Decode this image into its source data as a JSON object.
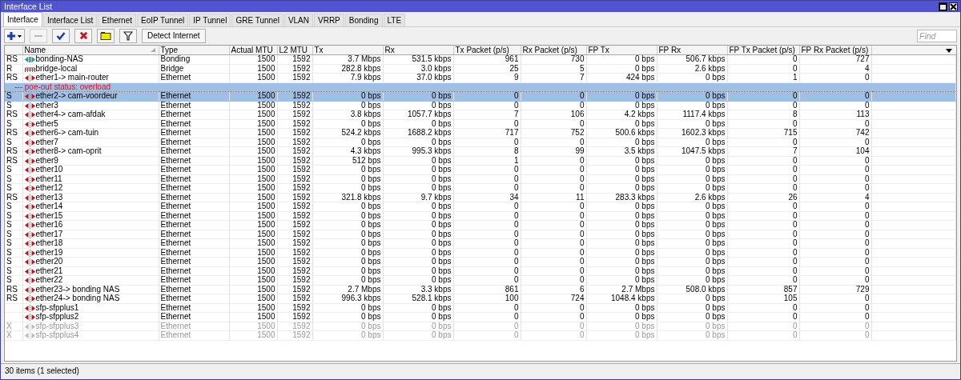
{
  "window": {
    "title": "Interface List"
  },
  "tabs": [
    {
      "label": "Interface",
      "selected": true
    },
    {
      "label": "Interface List",
      "selected": false
    },
    {
      "label": "Ethernet",
      "selected": false
    },
    {
      "label": "EoIP Tunnel",
      "selected": false
    },
    {
      "label": "IP Tunnel",
      "selected": false
    },
    {
      "label": "GRE Tunnel",
      "selected": false
    },
    {
      "label": "VLAN",
      "selected": false
    },
    {
      "label": "VRRP",
      "selected": false
    },
    {
      "label": "Bonding",
      "selected": false
    },
    {
      "label": "LTE",
      "selected": false
    }
  ],
  "toolbar": {
    "tools": [
      {
        "kind": "add",
        "disabled": false
      },
      {
        "kind": "remove",
        "disabled": true
      },
      {
        "kind": "enable",
        "disabled": false
      },
      {
        "kind": "disable",
        "disabled": false
      },
      {
        "kind": "comment",
        "disabled": false
      },
      {
        "kind": "filter",
        "disabled": false
      }
    ],
    "detect_button": "Detect Internet"
  },
  "search": {
    "placeholder": "Find"
  },
  "table": {
    "columns": [
      {
        "label": "Name",
        "sorted": true
      },
      {
        "label": "Type"
      },
      {
        "label": "Actual MTU"
      },
      {
        "label": "L2 MTU"
      },
      {
        "label": "Tx"
      },
      {
        "label": "Rx"
      },
      {
        "label": "Tx Packet (p/s)"
      },
      {
        "label": "Rx Packet (p/s)"
      },
      {
        "label": "FP Tx"
      },
      {
        "label": "FP Rx"
      },
      {
        "label": "FP Tx Packet (p/s)"
      },
      {
        "label": "FP Rx Packet (p/s)"
      }
    ],
    "rows": [
      {
        "flags": "RS",
        "kind": "bonding",
        "name": "bonding-NAS",
        "type": "Bonding",
        "actual_mtu": "1500",
        "l2_mtu": "1592",
        "tx": "3.7 Mbps",
        "rx": "531.5 kbps",
        "tx_packet": "961",
        "rx_packet": "730",
        "fp_tx": "0 bps",
        "fp_rx": "506.7 kbps",
        "fp_tx_packet": "0",
        "fp_rx_packet": "727",
        "selected": false,
        "disabled": false
      },
      {
        "flags": "R",
        "kind": "bridge",
        "name": "bridge-local",
        "type": "Bridge",
        "actual_mtu": "1500",
        "l2_mtu": "1592",
        "tx": "282.8 kbps",
        "rx": "3.0 kbps",
        "tx_packet": "25",
        "rx_packet": "5",
        "fp_tx": "0 bps",
        "fp_rx": "2.6 kbps",
        "fp_tx_packet": "0",
        "fp_rx_packet": "4",
        "selected": false,
        "disabled": false
      },
      {
        "flags": "RS",
        "kind": "ethernet",
        "name": "ether1-> main-router",
        "type": "Ethernet",
        "actual_mtu": "1500",
        "l2_mtu": "1592",
        "tx": "7.9 kbps",
        "rx": "37.0 kbps",
        "tx_packet": "9",
        "rx_packet": "7",
        "fp_tx": "424 bps",
        "fp_rx": "0 bps",
        "fp_tx_packet": "1",
        "fp_rx_packet": "0",
        "selected": false,
        "disabled": false
      },
      {
        "comment": "--- poe-out status: overload",
        "flags": "S",
        "kind": "ethernet",
        "name": "ether2-> cam-voordeur",
        "type": "Ethernet",
        "actual_mtu": "1500",
        "l2_mtu": "1592",
        "tx": "0 bps",
        "rx": "0 bps",
        "tx_packet": "0",
        "rx_packet": "0",
        "fp_tx": "0 bps",
        "fp_rx": "0 bps",
        "fp_tx_packet": "0",
        "fp_rx_packet": "0",
        "selected": true,
        "disabled": false
      },
      {
        "flags": "S",
        "kind": "ethernet",
        "name": "ether3",
        "type": "Ethernet",
        "actual_mtu": "1500",
        "l2_mtu": "1592",
        "tx": "0 bps",
        "rx": "0 bps",
        "tx_packet": "0",
        "rx_packet": "0",
        "fp_tx": "0 bps",
        "fp_rx": "0 bps",
        "fp_tx_packet": "0",
        "fp_rx_packet": "0",
        "selected": false,
        "disabled": false
      },
      {
        "flags": "RS",
        "kind": "ethernet",
        "name": "ether4-> cam-afdak",
        "type": "Ethernet",
        "actual_mtu": "1500",
        "l2_mtu": "1592",
        "tx": "3.8 kbps",
        "rx": "1057.7 kbps",
        "tx_packet": "7",
        "rx_packet": "106",
        "fp_tx": "4.2 kbps",
        "fp_rx": "1117.4 kbps",
        "fp_tx_packet": "8",
        "fp_rx_packet": "113",
        "selected": false,
        "disabled": false
      },
      {
        "flags": "S",
        "kind": "ethernet",
        "name": "ether5",
        "type": "Ethernet",
        "actual_mtu": "1500",
        "l2_mtu": "1592",
        "tx": "0 bps",
        "rx": "0 bps",
        "tx_packet": "0",
        "rx_packet": "0",
        "fp_tx": "0 bps",
        "fp_rx": "0 bps",
        "fp_tx_packet": "0",
        "fp_rx_packet": "0",
        "selected": false,
        "disabled": false
      },
      {
        "flags": "RS",
        "kind": "ethernet",
        "name": "ether6-> cam-tuin",
        "type": "Ethernet",
        "actual_mtu": "1500",
        "l2_mtu": "1592",
        "tx": "524.2 kbps",
        "rx": "1688.2 kbps",
        "tx_packet": "717",
        "rx_packet": "752",
        "fp_tx": "500.6 kbps",
        "fp_rx": "1602.3 kbps",
        "fp_tx_packet": "715",
        "fp_rx_packet": "742",
        "selected": false,
        "disabled": false
      },
      {
        "flags": "S",
        "kind": "ethernet",
        "name": "ether7",
        "type": "Ethernet",
        "actual_mtu": "1500",
        "l2_mtu": "1592",
        "tx": "0 bps",
        "rx": "0 bps",
        "tx_packet": "0",
        "rx_packet": "0",
        "fp_tx": "0 bps",
        "fp_rx": "0 bps",
        "fp_tx_packet": "0",
        "fp_rx_packet": "0",
        "selected": false,
        "disabled": false
      },
      {
        "flags": "RS",
        "kind": "ethernet",
        "name": "ether8-> cam-oprit",
        "type": "Ethernet",
        "actual_mtu": "1500",
        "l2_mtu": "1592",
        "tx": "4.3 kbps",
        "rx": "995.3 kbps",
        "tx_packet": "8",
        "rx_packet": "99",
        "fp_tx": "3.5 kbps",
        "fp_rx": "1047.5 kbps",
        "fp_tx_packet": "7",
        "fp_rx_packet": "104",
        "selected": false,
        "disabled": false
      },
      {
        "flags": "RS",
        "kind": "ethernet",
        "name": "ether9",
        "type": "Ethernet",
        "actual_mtu": "1500",
        "l2_mtu": "1592",
        "tx": "512 bps",
        "rx": "0 bps",
        "tx_packet": "1",
        "rx_packet": "0",
        "fp_tx": "0 bps",
        "fp_rx": "0 bps",
        "fp_tx_packet": "0",
        "fp_rx_packet": "0",
        "selected": false,
        "disabled": false
      },
      {
        "flags": "S",
        "kind": "ethernet",
        "name": "ether10",
        "type": "Ethernet",
        "actual_mtu": "1500",
        "l2_mtu": "1592",
        "tx": "0 bps",
        "rx": "0 bps",
        "tx_packet": "0",
        "rx_packet": "0",
        "fp_tx": "0 bps",
        "fp_rx": "0 bps",
        "fp_tx_packet": "0",
        "fp_rx_packet": "0",
        "selected": false,
        "disabled": false
      },
      {
        "flags": "S",
        "kind": "ethernet",
        "name": "ether11",
        "type": "Ethernet",
        "actual_mtu": "1500",
        "l2_mtu": "1592",
        "tx": "0 bps",
        "rx": "0 bps",
        "tx_packet": "0",
        "rx_packet": "0",
        "fp_tx": "0 bps",
        "fp_rx": "0 bps",
        "fp_tx_packet": "0",
        "fp_rx_packet": "0",
        "selected": false,
        "disabled": false
      },
      {
        "flags": "S",
        "kind": "ethernet",
        "name": "ether12",
        "type": "Ethernet",
        "actual_mtu": "1500",
        "l2_mtu": "1592",
        "tx": "0 bps",
        "rx": "0 bps",
        "tx_packet": "0",
        "rx_packet": "0",
        "fp_tx": "0 bps",
        "fp_rx": "0 bps",
        "fp_tx_packet": "0",
        "fp_rx_packet": "0",
        "selected": false,
        "disabled": false
      },
      {
        "flags": "RS",
        "kind": "ethernet",
        "name": "ether13",
        "type": "Ethernet",
        "actual_mtu": "1500",
        "l2_mtu": "1592",
        "tx": "321.8 kbps",
        "rx": "9.7 kbps",
        "tx_packet": "34",
        "rx_packet": "11",
        "fp_tx": "283.3 kbps",
        "fp_rx": "2.6 kbps",
        "fp_tx_packet": "26",
        "fp_rx_packet": "4",
        "selected": false,
        "disabled": false
      },
      {
        "flags": "S",
        "kind": "ethernet",
        "name": "ether14",
        "type": "Ethernet",
        "actual_mtu": "1500",
        "l2_mtu": "1592",
        "tx": "0 bps",
        "rx": "0 bps",
        "tx_packet": "0",
        "rx_packet": "0",
        "fp_tx": "0 bps",
        "fp_rx": "0 bps",
        "fp_tx_packet": "0",
        "fp_rx_packet": "0",
        "selected": false,
        "disabled": false
      },
      {
        "flags": "S",
        "kind": "ethernet",
        "name": "ether15",
        "type": "Ethernet",
        "actual_mtu": "1500",
        "l2_mtu": "1592",
        "tx": "0 bps",
        "rx": "0 bps",
        "tx_packet": "0",
        "rx_packet": "0",
        "fp_tx": "0 bps",
        "fp_rx": "0 bps",
        "fp_tx_packet": "0",
        "fp_rx_packet": "0",
        "selected": false,
        "disabled": false
      },
      {
        "flags": "S",
        "kind": "ethernet",
        "name": "ether16",
        "type": "Ethernet",
        "actual_mtu": "1500",
        "l2_mtu": "1592",
        "tx": "0 bps",
        "rx": "0 bps",
        "tx_packet": "0",
        "rx_packet": "0",
        "fp_tx": "0 bps",
        "fp_rx": "0 bps",
        "fp_tx_packet": "0",
        "fp_rx_packet": "0",
        "selected": false,
        "disabled": false
      },
      {
        "flags": "S",
        "kind": "ethernet",
        "name": "ether17",
        "type": "Ethernet",
        "actual_mtu": "1500",
        "l2_mtu": "1592",
        "tx": "0 bps",
        "rx": "0 bps",
        "tx_packet": "0",
        "rx_packet": "0",
        "fp_tx": "0 bps",
        "fp_rx": "0 bps",
        "fp_tx_packet": "0",
        "fp_rx_packet": "0",
        "selected": false,
        "disabled": false
      },
      {
        "flags": "S",
        "kind": "ethernet",
        "name": "ether18",
        "type": "Ethernet",
        "actual_mtu": "1500",
        "l2_mtu": "1592",
        "tx": "0 bps",
        "rx": "0 bps",
        "tx_packet": "0",
        "rx_packet": "0",
        "fp_tx": "0 bps",
        "fp_rx": "0 bps",
        "fp_tx_packet": "0",
        "fp_rx_packet": "0",
        "selected": false,
        "disabled": false
      },
      {
        "flags": "S",
        "kind": "ethernet",
        "name": "ether19",
        "type": "Ethernet",
        "actual_mtu": "1500",
        "l2_mtu": "1592",
        "tx": "0 bps",
        "rx": "0 bps",
        "tx_packet": "0",
        "rx_packet": "0",
        "fp_tx": "0 bps",
        "fp_rx": "0 bps",
        "fp_tx_packet": "0",
        "fp_rx_packet": "0",
        "selected": false,
        "disabled": false
      },
      {
        "flags": "S",
        "kind": "ethernet",
        "name": "ether20",
        "type": "Ethernet",
        "actual_mtu": "1500",
        "l2_mtu": "1592",
        "tx": "0 bps",
        "rx": "0 bps",
        "tx_packet": "0",
        "rx_packet": "0",
        "fp_tx": "0 bps",
        "fp_rx": "0 bps",
        "fp_tx_packet": "0",
        "fp_rx_packet": "0",
        "selected": false,
        "disabled": false
      },
      {
        "flags": "S",
        "kind": "ethernet",
        "name": "ether21",
        "type": "Ethernet",
        "actual_mtu": "1500",
        "l2_mtu": "1592",
        "tx": "0 bps",
        "rx": "0 bps",
        "tx_packet": "0",
        "rx_packet": "0",
        "fp_tx": "0 bps",
        "fp_rx": "0 bps",
        "fp_tx_packet": "0",
        "fp_rx_packet": "0",
        "selected": false,
        "disabled": false
      },
      {
        "flags": "S",
        "kind": "ethernet",
        "name": "ether22",
        "type": "Ethernet",
        "actual_mtu": "1500",
        "l2_mtu": "1592",
        "tx": "0 bps",
        "rx": "0 bps",
        "tx_packet": "0",
        "rx_packet": "0",
        "fp_tx": "0 bps",
        "fp_rx": "0 bps",
        "fp_tx_packet": "0",
        "fp_rx_packet": "0",
        "selected": false,
        "disabled": false
      },
      {
        "flags": "RS",
        "kind": "ethernet",
        "name": "ether23-> bonding NAS",
        "type": "Ethernet",
        "actual_mtu": "1500",
        "l2_mtu": "1592",
        "tx": "2.7 Mbps",
        "rx": "3.3 kbps",
        "tx_packet": "861",
        "rx_packet": "6",
        "fp_tx": "2.7 Mbps",
        "fp_rx": "508.0 kbps",
        "fp_tx_packet": "857",
        "fp_rx_packet": "729",
        "selected": false,
        "disabled": false
      },
      {
        "flags": "RS",
        "kind": "ethernet",
        "name": "ether24-> bonding NAS",
        "type": "Ethernet",
        "actual_mtu": "1500",
        "l2_mtu": "1592",
        "tx": "996.3 kbps",
        "rx": "528.1 kbps",
        "tx_packet": "100",
        "rx_packet": "724",
        "fp_tx": "1048.4 kbps",
        "fp_rx": "0 bps",
        "fp_tx_packet": "105",
        "fp_rx_packet": "0",
        "selected": false,
        "disabled": false
      },
      {
        "kind": "ethernet",
        "name": "sfp-sfpplus1",
        "type": "Ethernet",
        "actual_mtu": "1500",
        "l2_mtu": "1592",
        "tx": "0 bps",
        "rx": "0 bps",
        "tx_packet": "0",
        "rx_packet": "0",
        "fp_tx": "0 bps",
        "fp_rx": "0 bps",
        "fp_tx_packet": "0",
        "fp_rx_packet": "0",
        "selected": false,
        "disabled": false
      },
      {
        "kind": "ethernet",
        "name": "sfp-sfpplus2",
        "type": "Ethernet",
        "actual_mtu": "1500",
        "l2_mtu": "1592",
        "tx": "0 bps",
        "rx": "0 bps",
        "tx_packet": "0",
        "rx_packet": "0",
        "fp_tx": "0 bps",
        "fp_rx": "0 bps",
        "fp_tx_packet": "0",
        "fp_rx_packet": "0",
        "selected": false,
        "disabled": false
      },
      {
        "flags": "X",
        "kind": "ethernet",
        "name": "sfp-sfpplus3",
        "type": "Ethernet",
        "actual_mtu": "1500",
        "l2_mtu": "1592",
        "tx": "0 bps",
        "rx": "0 bps",
        "tx_packet": "0",
        "rx_packet": "0",
        "fp_tx": "0 bps",
        "fp_rx": "0 bps",
        "fp_tx_packet": "0",
        "fp_rx_packet": "0",
        "selected": false,
        "disabled": true
      },
      {
        "flags": "X",
        "kind": "ethernet",
        "name": "sfp-sfpplus4",
        "type": "Ethernet",
        "actual_mtu": "1500",
        "l2_mtu": "1592",
        "tx": "0 bps",
        "rx": "0 bps",
        "tx_packet": "0",
        "rx_packet": "0",
        "fp_tx": "0 bps",
        "fp_rx": "0 bps",
        "fp_tx_packet": "0",
        "fp_rx_packet": "0",
        "selected": false,
        "disabled": true
      }
    ]
  },
  "status_bar": {
    "text": "30 items (1 selected)"
  }
}
